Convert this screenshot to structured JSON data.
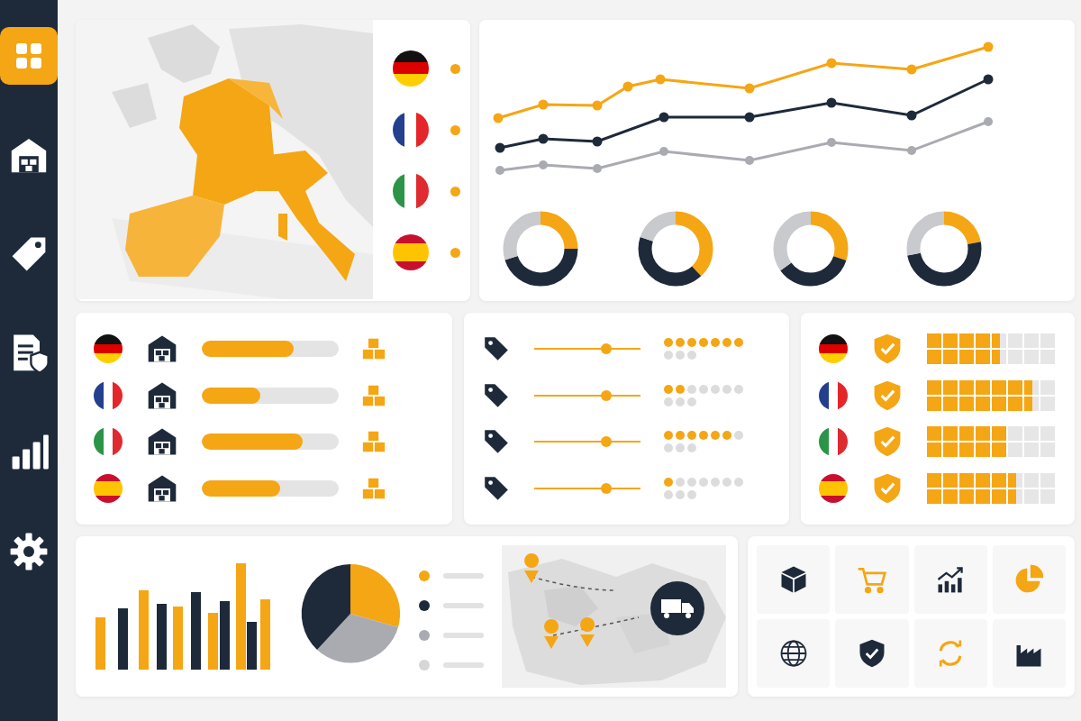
{
  "sidebar": {
    "items": [
      {
        "kind": "dashboard",
        "selected": true
      },
      {
        "kind": "warehouse",
        "selected": false
      },
      {
        "kind": "tag",
        "selected": false
      },
      {
        "kind": "document",
        "selected": false
      },
      {
        "kind": "chart",
        "selected": false
      },
      {
        "kind": "settings",
        "selected": false
      }
    ]
  },
  "map_flags": [
    {
      "kind": "de",
      "color": "#f5a614"
    },
    {
      "kind": "fr",
      "color": "#f5a614"
    },
    {
      "kind": "it",
      "color": "#f5a614"
    },
    {
      "kind": "es",
      "color": "#f5a614"
    }
  ],
  "stock_rows": [
    {
      "kind": "de",
      "level": 0.67
    },
    {
      "kind": "fr",
      "level": 0.43
    },
    {
      "kind": "it",
      "level": 0.74
    },
    {
      "kind": "es",
      "level": 0.57
    }
  ],
  "price_rows": [
    {
      "level": 0.68,
      "dots": [
        {
          "filled": true
        },
        {
          "filled": true
        },
        {
          "filled": true
        },
        {
          "filled": true
        },
        {
          "filled": true
        },
        {
          "filled": true
        },
        {
          "filled": true
        },
        {
          "filled": false
        },
        {
          "filled": false
        },
        {
          "filled": false
        }
      ]
    },
    {
      "level": 0.68,
      "dots": [
        {
          "filled": true
        },
        {
          "filled": true
        },
        {
          "filled": false
        },
        {
          "filled": false
        },
        {
          "filled": false
        },
        {
          "filled": false
        },
        {
          "filled": false
        },
        {
          "filled": false
        },
        {
          "filled": false
        },
        {
          "filled": false
        }
      ]
    },
    {
      "level": 0.68,
      "dots": [
        {
          "filled": true
        },
        {
          "filled": true
        },
        {
          "filled": true
        },
        {
          "filled": true
        },
        {
          "filled": true
        },
        {
          "filled": true
        },
        {
          "filled": false
        },
        {
          "filled": false
        },
        {
          "filled": false
        },
        {
          "filled": false
        }
      ]
    },
    {
      "level": 0.68,
      "dots": [
        {
          "filled": true
        },
        {
          "filled": false
        },
        {
          "filled": false
        },
        {
          "filled": false
        },
        {
          "filled": false
        },
        {
          "filled": false
        },
        {
          "filled": false
        },
        {
          "filled": false
        },
        {
          "filled": false
        },
        {
          "filled": false
        }
      ]
    }
  ],
  "compliance_rows": [
    {
      "kind": "de",
      "level": 0.56
    },
    {
      "kind": "fr",
      "level": 0.81
    },
    {
      "kind": "it",
      "level": 0.62
    },
    {
      "kind": "es",
      "level": 0.69
    }
  ],
  "legend": [
    {
      "color": "#f5a614"
    },
    {
      "color": "#1e2a3a"
    },
    {
      "color": "#a9abb0"
    },
    {
      "color": "#d6d6d6"
    }
  ],
  "tiles": [
    {
      "kind": "box"
    },
    {
      "kind": "cart"
    },
    {
      "kind": "trend"
    },
    {
      "kind": "pie"
    },
    {
      "kind": "globe"
    },
    {
      "kind": "shield"
    },
    {
      "kind": "refresh"
    },
    {
      "kind": "factory"
    }
  ]
}
